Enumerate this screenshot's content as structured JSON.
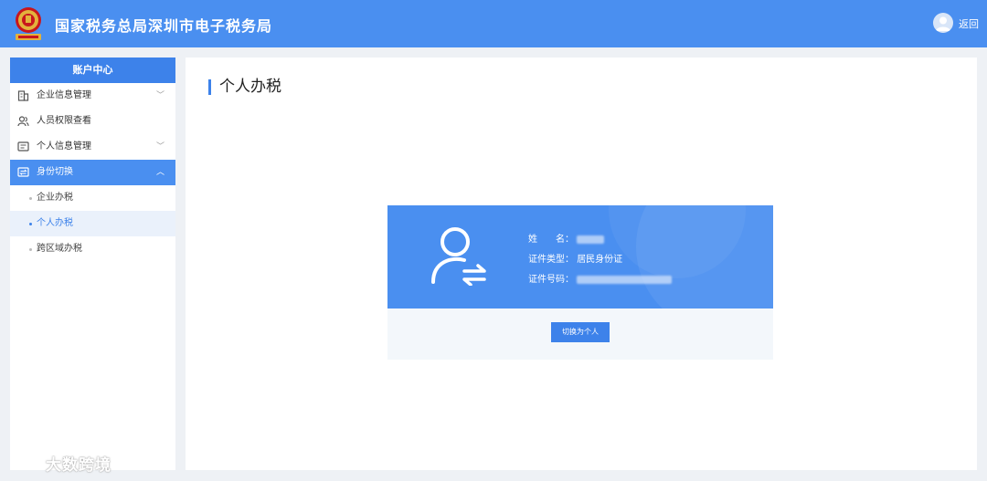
{
  "header": {
    "title": "国家税务总局深圳市电子税务局",
    "back_label": "返回"
  },
  "sidebar": {
    "title": "账户中心",
    "items": [
      {
        "label": "企业信息管理",
        "icon": "building-icon",
        "chevron": "﹀"
      },
      {
        "label": "人员权限查看",
        "icon": "people-icon",
        "chevron": ""
      },
      {
        "label": "个人信息管理",
        "icon": "id-card-icon",
        "chevron": "﹀"
      },
      {
        "label": "身份切换",
        "icon": "switch-identity-icon",
        "chevron": "︿"
      }
    ],
    "subitems": [
      {
        "label": "企业办税"
      },
      {
        "label": "个人办税"
      },
      {
        "label": "跨区域办税"
      }
    ]
  },
  "main": {
    "page_title": "个人办税",
    "card": {
      "name_label": "姓　　名：",
      "id_type_label": "证件类型：",
      "id_type_value": "居民身份证",
      "id_number_label": "证件号码：",
      "switch_button": "切换为个人"
    }
  },
  "watermark": {
    "text": "大数跨境"
  },
  "colors": {
    "primary": "#4a8ff0",
    "sidebar_header": "#3d82ea",
    "background": "#eef1f5"
  }
}
